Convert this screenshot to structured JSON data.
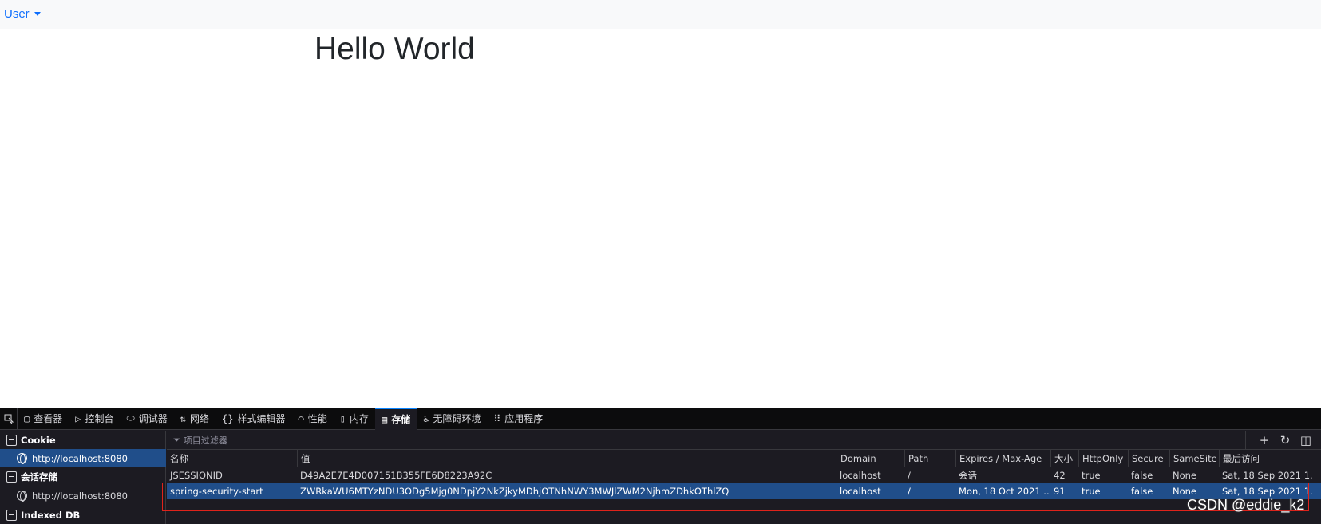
{
  "navbar": {
    "user_label": "User"
  },
  "page": {
    "heading": "Hello World"
  },
  "devtools": {
    "tabs": [
      {
        "icon": "inspector-icon",
        "label": "查看器"
      },
      {
        "icon": "console-icon",
        "label": "控制台"
      },
      {
        "icon": "debugger-icon",
        "label": "调试器"
      },
      {
        "icon": "network-icon",
        "label": "网络"
      },
      {
        "icon": "style-editor-icon",
        "label": "样式编辑器"
      },
      {
        "icon": "performance-icon",
        "label": "性能"
      },
      {
        "icon": "memory-icon",
        "label": "内存"
      },
      {
        "icon": "storage-icon",
        "label": "存储",
        "active": true
      },
      {
        "icon": "accessibility-icon",
        "label": "无障碍环境"
      },
      {
        "icon": "application-icon",
        "label": "应用程序"
      }
    ],
    "sidebar": {
      "cookie_label": "Cookie",
      "cookie_host": "http://localhost:8080",
      "session_label": "会话存储",
      "session_host": "http://localhost:8080",
      "indexeddb_label": "Indexed DB"
    },
    "filter_placeholder": "项目过滤器",
    "table": {
      "headers": [
        "名称",
        "值",
        "Domain",
        "Path",
        "Expires / Max-Age",
        "大小",
        "HttpOnly",
        "Secure",
        "SameSite",
        "最后访问"
      ],
      "rows": [
        [
          "JSESSIONID",
          "D49A2E7E4D007151B355FE6D8223A92C",
          "localhost",
          "/",
          "会话",
          "42",
          "true",
          "false",
          "None",
          "Sat, 18 Sep 2021 1..."
        ],
        [
          "spring-security-start",
          "ZWRkaWU6MTYzNDU3ODg5Mjg0NDpjY2NkZjkyMDhjOTNhNWY3MWJlZWM2NjhmZDhkOThlZQ",
          "localhost",
          "/",
          "Mon, 18 Oct 2021 ...",
          "91",
          "true",
          "false",
          "None",
          "Sat, 18 Sep 2021 1..."
        ]
      ]
    }
  },
  "watermark": "CSDN @eddie_k2",
  "colors": {
    "link": "#0d6efd",
    "selection": "#204e8a",
    "highlight": "#e0231b"
  }
}
